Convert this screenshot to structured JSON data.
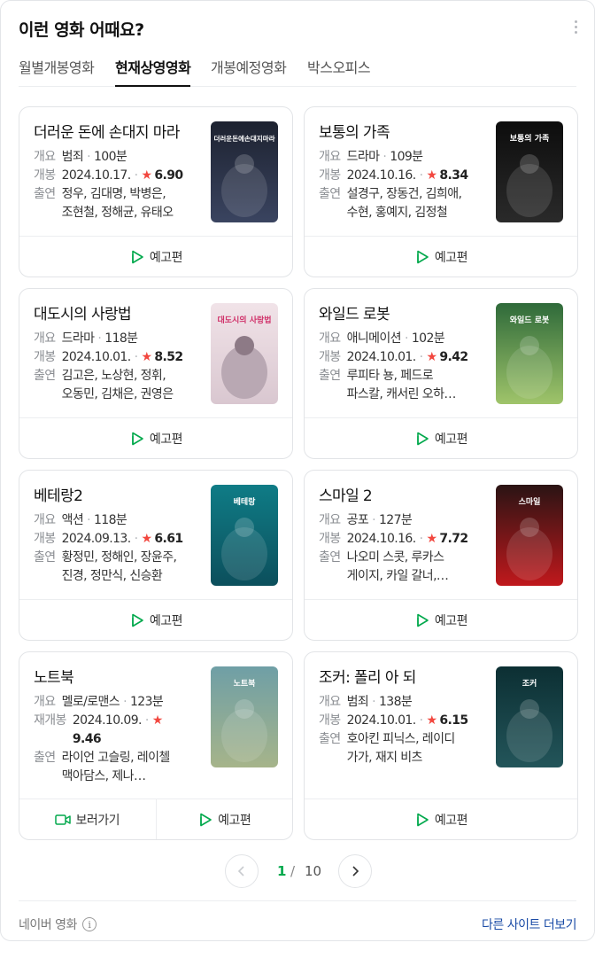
{
  "header": {
    "title": "이런 영화 어때요?"
  },
  "tabs": [
    "월별개봉영화",
    "현재상영영화",
    "개봉예정영화",
    "박스오피스"
  ],
  "labels": {
    "summary": "개요",
    "release": "개봉",
    "rerelease": "재개봉",
    "cast": "출연",
    "trailer": "예고편",
    "watch": "보러가기"
  },
  "movies": [
    {
      "title": "더러운 돈에 손대지 마라",
      "genre": "범죄",
      "runtime": "100분",
      "date": "2024.10.17.",
      "score": "6.90",
      "cast1": "정우, 김대명, 박병은,",
      "cast2": "조현철, 정해균, 유태오",
      "poster": "더러운돈에손대지마라",
      "colors": [
        "#1d2230",
        "#3a4460"
      ]
    },
    {
      "title": "보통의 가족",
      "genre": "드라마",
      "runtime": "109분",
      "date": "2024.10.16.",
      "score": "8.34",
      "cast1": "설경구, 장동건, 김희애,",
      "cast2": "수현, 홍예지, 김정철",
      "poster": "보통의 가족",
      "colors": [
        "#0d0d0d",
        "#2a2a2a"
      ]
    },
    {
      "title": "대도시의 사랑법",
      "genre": "드라마",
      "runtime": "118분",
      "date": "2024.10.01.",
      "score": "8.52",
      "cast1": "김고은, 노상현, 정휘,",
      "cast2": "오동민, 김채은, 권영은",
      "poster": "대도시의 사랑법",
      "colors": [
        "#f1e3e8",
        "#d9c7d0"
      ]
    },
    {
      "title": "와일드 로봇",
      "genre": "애니메이션",
      "runtime": "102분",
      "date": "2024.10.01.",
      "score": "9.42",
      "cast1": "루피타 뇽, 페드로",
      "cast2": "파스칼, 캐서린 오하…",
      "poster": "와일드 로봇",
      "colors": [
        "#2f6a3a",
        "#9fc46a"
      ]
    },
    {
      "title": "베테랑2",
      "genre": "액션",
      "runtime": "118분",
      "date": "2024.09.13.",
      "score": "6.61",
      "cast1": "황정민, 정해인, 장윤주,",
      "cast2": "진경, 정만식, 신승환",
      "poster": "베테랑",
      "colors": [
        "#0f7c86",
        "#0c4f5c"
      ]
    },
    {
      "title": "스마일 2",
      "genre": "공포",
      "runtime": "127분",
      "date": "2024.10.16.",
      "score": "7.72",
      "cast1": "나오미 스콧, 루카스",
      "cast2": "게이지, 카일 갈너,…",
      "poster": "스마일",
      "colors": [
        "#2a1414",
        "#c0181c"
      ]
    },
    {
      "title": "노트북",
      "genre": "멜로/로맨스",
      "runtime": "123분",
      "date": "2024.10.09.",
      "score": "9.46",
      "cast1": "라이언 고슬링, 레이첼",
      "cast2": "맥아담스, 제나…",
      "poster": "노트북",
      "colors": [
        "#6f9fa6",
        "#a6b48a"
      ]
    },
    {
      "title": "조커: 폴리 아 되",
      "genre": "범죄",
      "runtime": "138분",
      "date": "2024.10.01.",
      "score": "6.15",
      "cast1": "호아킨 피닉스, 레이디",
      "cast2": "가가, 재지 비츠",
      "poster": "조커",
      "colors": [
        "#0c2f33",
        "#23555a"
      ]
    }
  ],
  "pagination": {
    "current": "1",
    "separator": "/",
    "total": "10"
  },
  "footer": {
    "source": "네이버 영화",
    "info_icon": "i",
    "other_sites": "다른 사이트 더보기"
  },
  "accent": "#03a94d"
}
